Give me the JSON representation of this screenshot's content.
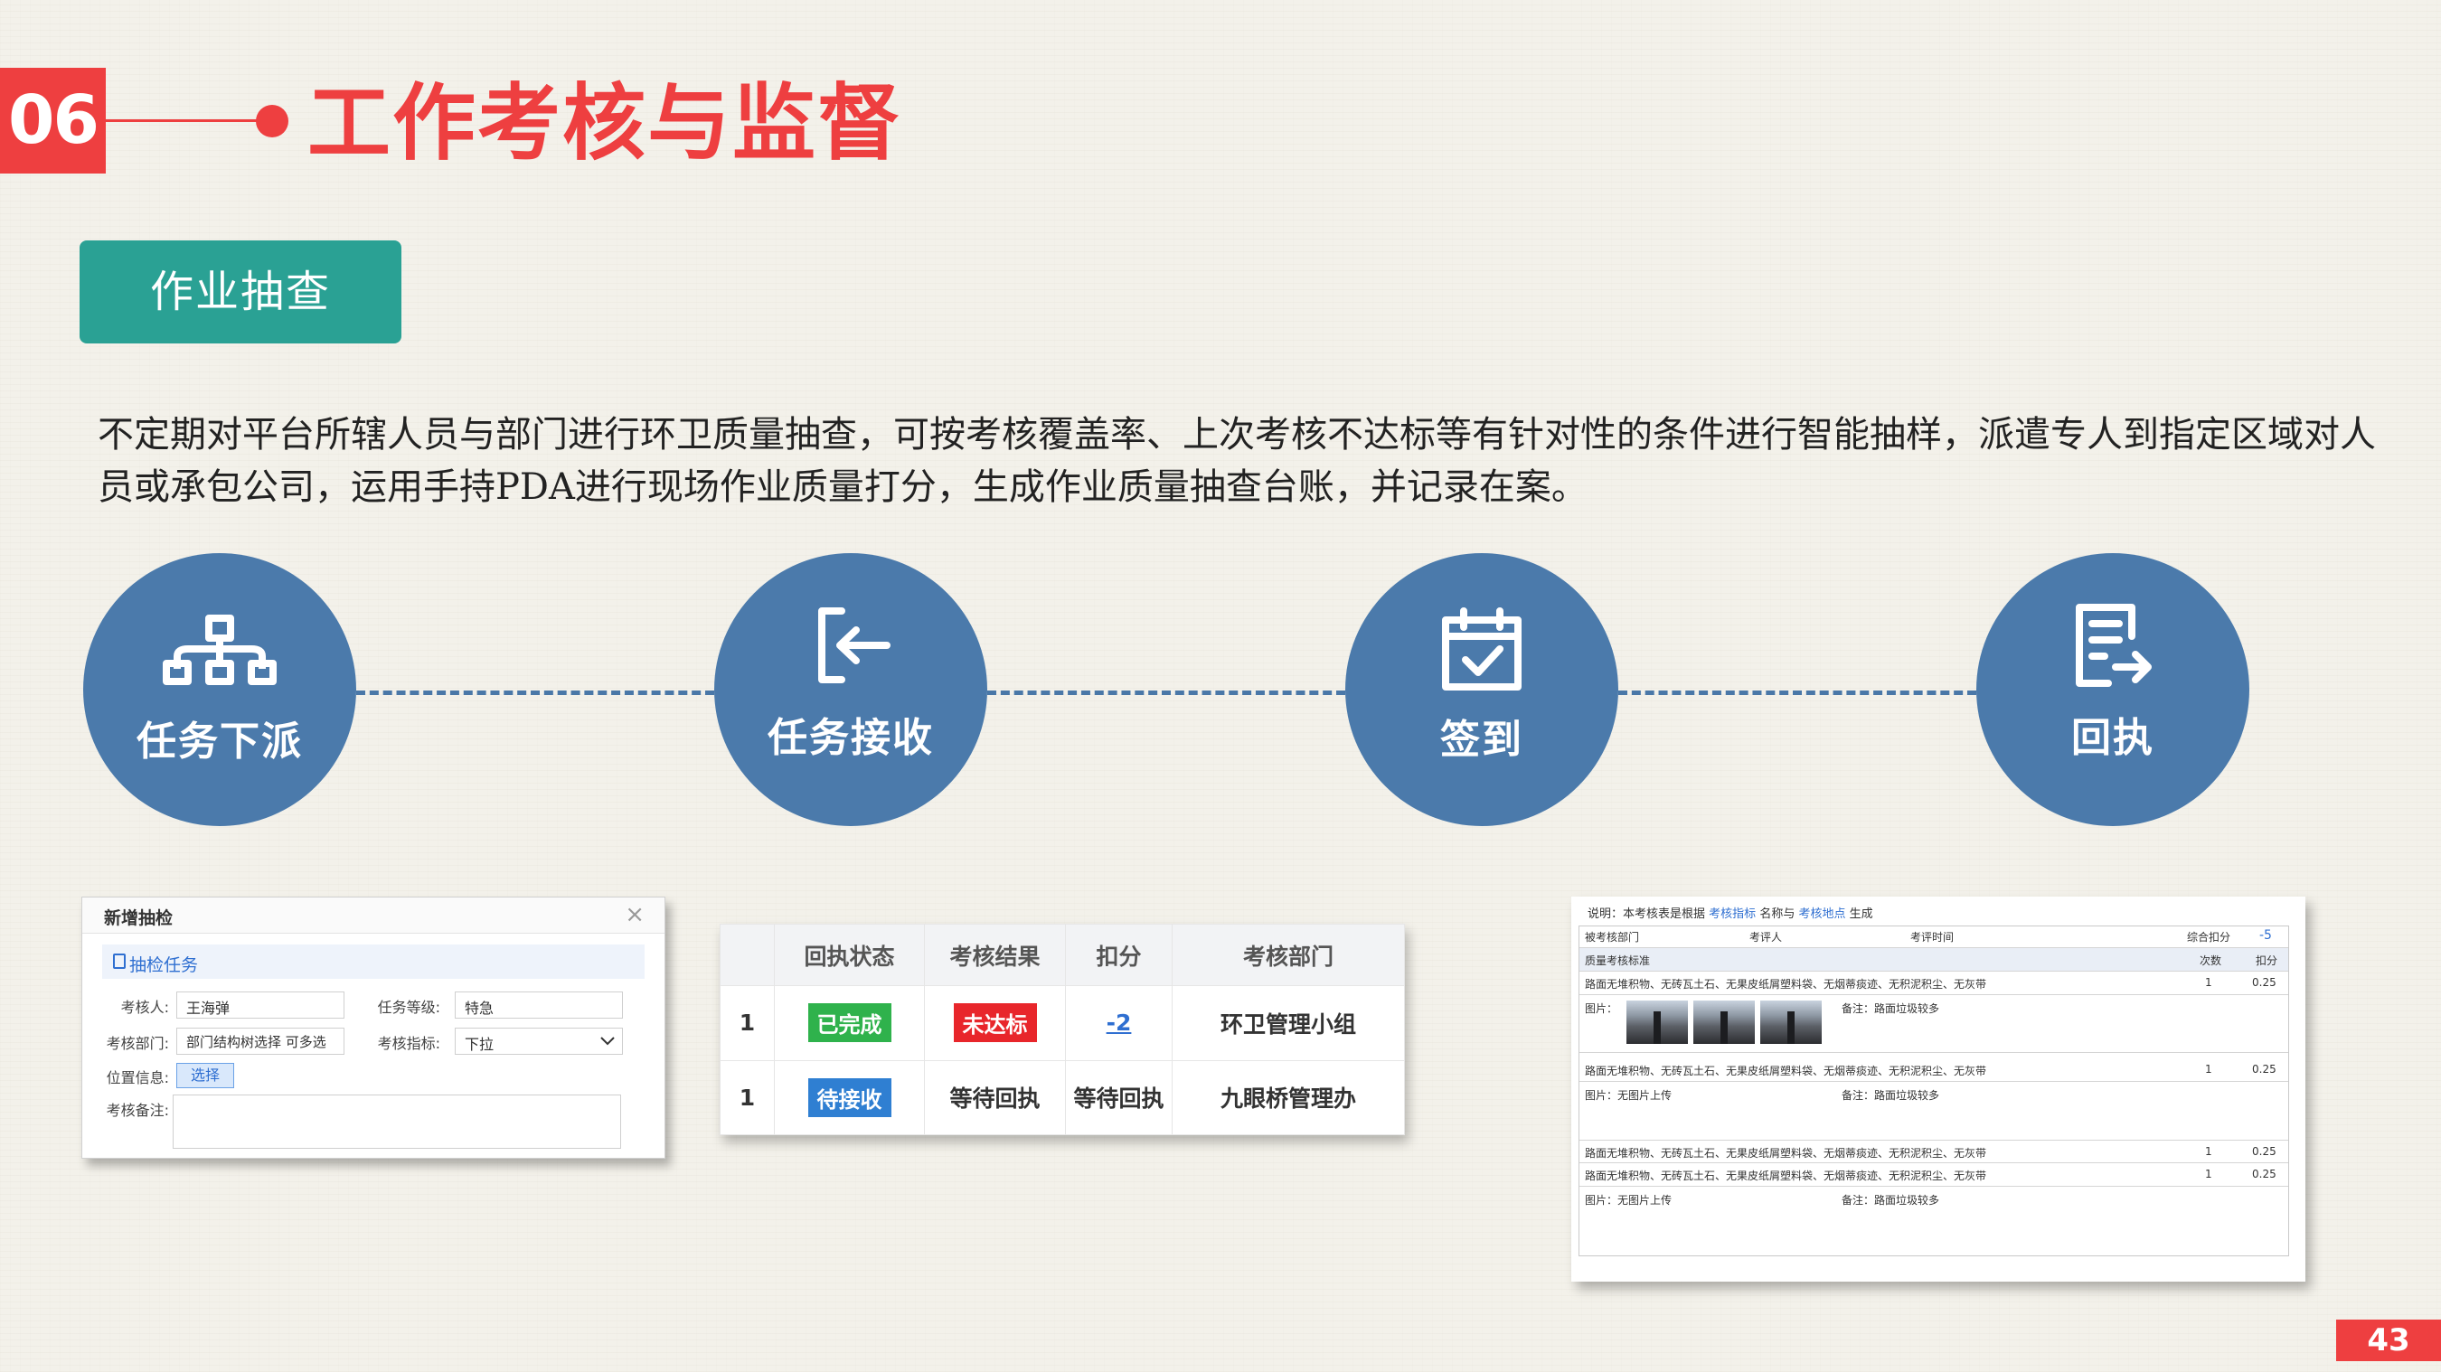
{
  "header": {
    "section_number": "06",
    "title": "工作考核与监督",
    "tag": "作业抽查"
  },
  "description": "不定期对平台所辖人员与部门进行环卫质量抽查，可按考核覆盖率、上次考核不达标等有针对性的条件进行智能抽样，派遣专人到指定区域对人员或承包公司，运用手持PDA进行现场作业质量打分，生成作业质量抽查台账，并记录在案。",
  "flow_steps": [
    {
      "label": "任务下派",
      "icon": "hierarchy-icon"
    },
    {
      "label": "任务接收",
      "icon": "sign-in-icon"
    },
    {
      "label": "签到",
      "icon": "calendar-check-icon"
    },
    {
      "label": "回执",
      "icon": "document-arrow-icon"
    }
  ],
  "form": {
    "title": "新增抽检",
    "section": "抽检任务",
    "assessor_label": "考核人:",
    "assessor_value": "王海弹",
    "level_label": "任务等级:",
    "level_value": "特急",
    "dept_label": "考核部门:",
    "dept_placeholder": "部门结构树选择  可多选",
    "index_label": "考核指标:",
    "index_value": "下拉",
    "location_label": "位置信息:",
    "select_button": "选择",
    "remark_label": "考核备注:"
  },
  "status_table": {
    "headers": [
      "",
      "回执状态",
      "考核结果",
      "扣分",
      "考核部门"
    ],
    "rows": [
      {
        "no": "1",
        "status": "已完成",
        "result": "未达标",
        "score": "-2",
        "dept": "环卫管理小组"
      },
      {
        "no": "1",
        "status": "待接收",
        "result": "等待回执",
        "score": "等待回执",
        "dept": "九眼桥管理办"
      }
    ]
  },
  "report": {
    "note_pre": "说明：本考核表是根据",
    "note_link1": "考核指标",
    "note_mid": "名称与",
    "note_link2": "考核地点",
    "note_post": "生成",
    "h_dept": "被考核部门",
    "h_reviewer": "考评人",
    "h_time": "考评时间",
    "h_total": "综合扣分",
    "total_value": "-5",
    "std_label": "质量考核标准",
    "col_count": "次数",
    "col_deduct": "扣分",
    "item_text": "路面无堆积物、无砖瓦土石、无果皮纸屑塑料袋、无烟蒂痰迹、无积泥积尘、无灰带",
    "count": "1",
    "deduct": "0.25",
    "img_label": "图片：",
    "no_img": "图片：无图片上传",
    "remark": "备注：路面垃圾较多"
  },
  "page_number": "43",
  "colors": {
    "accent": "#ee3f40",
    "teal": "#2aa194",
    "step_blue": "#4b7aab"
  }
}
